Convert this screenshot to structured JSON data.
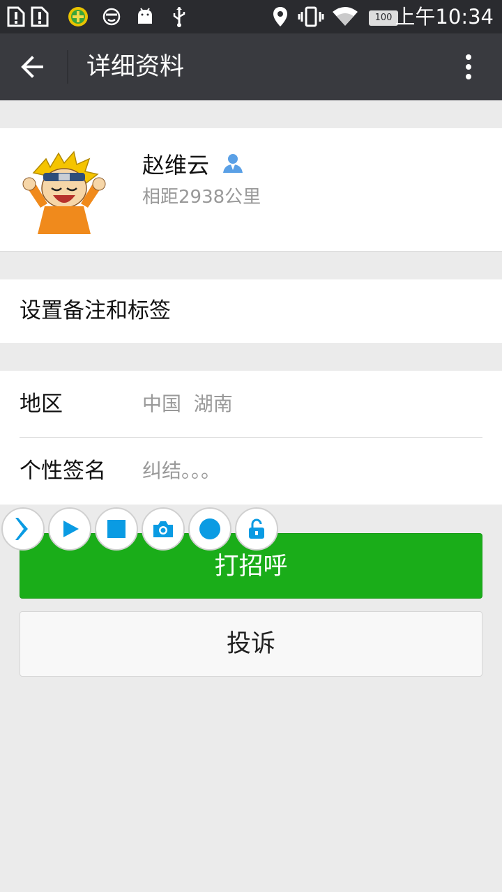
{
  "status_bar": {
    "time": "上午10:34",
    "battery": "100",
    "icons": [
      "sim-alert-icon",
      "sim-alert-icon",
      "app-plus-icon",
      "face-icon",
      "android-icon",
      "usb-icon",
      "location-icon",
      "vibrate-icon",
      "wifi-icon",
      "battery-icon"
    ]
  },
  "app_bar": {
    "title": "详细资料",
    "back_icon": "back-arrow-icon",
    "more_icon": "more-vertical-icon"
  },
  "profile": {
    "name": "赵维云",
    "distance": "相距2938公里",
    "contact_icon": "contact-person-icon",
    "avatar": "cartoon-avatar"
  },
  "remark": {
    "label": "设置备注和标签"
  },
  "details": {
    "rows": [
      {
        "key": "地区",
        "value": "中国  湖南"
      },
      {
        "key": "个性签名",
        "value": "纠结。。。"
      }
    ]
  },
  "actions": {
    "primary": "打招呼",
    "secondary": "投诉"
  },
  "floating_toolbar": {
    "icons": [
      "expand-icon",
      "play-icon",
      "stop-icon",
      "camera-icon",
      "record-icon",
      "unlock-icon"
    ]
  },
  "colors": {
    "status_bar": "#2a2b2f",
    "app_bar": "#393a3f",
    "background": "#ebebeb",
    "primary_button": "#1aad19",
    "toolbar_accent": "#0a9be3"
  }
}
